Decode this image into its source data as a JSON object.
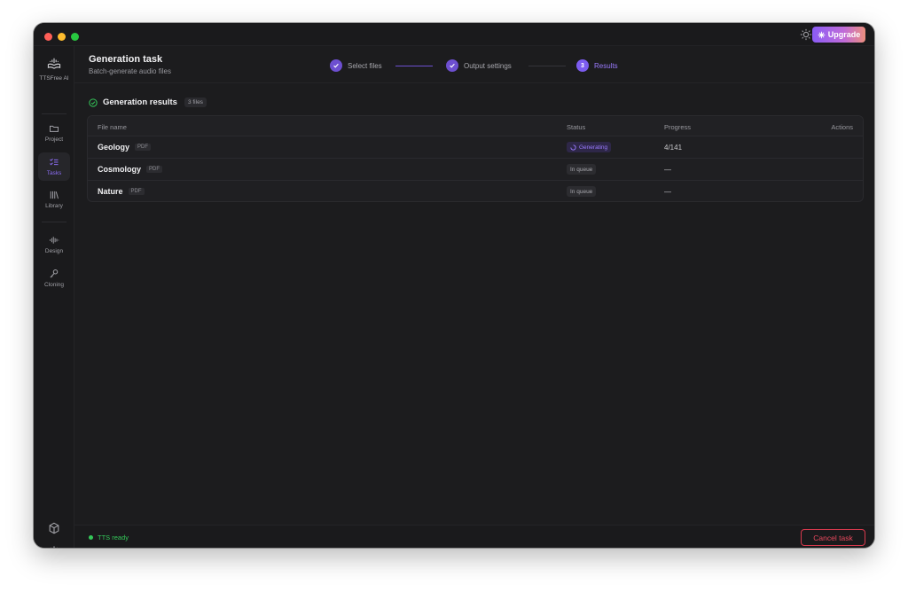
{
  "app": {
    "name": "TTSFree AI"
  },
  "titlebar": {
    "upgrade_label": "Upgrade"
  },
  "sidebar": {
    "items": [
      {
        "label": "Project",
        "icon": "folder-icon"
      },
      {
        "label": "Tasks",
        "icon": "tasks-icon",
        "active": true
      },
      {
        "label": "Library",
        "icon": "library-icon"
      },
      {
        "label": "Design",
        "icon": "waveform-icon"
      },
      {
        "label": "Cloning",
        "icon": "microphone-icon"
      }
    ],
    "bottom_icons": [
      "cube-icon",
      "gear-icon"
    ]
  },
  "header": {
    "title": "Generation task",
    "subtitle": "Batch-generate audio files",
    "steps": [
      {
        "label": "Select files",
        "state": "done"
      },
      {
        "label": "Output settings",
        "state": "done"
      },
      {
        "label": "Results",
        "number": "3",
        "state": "current"
      }
    ]
  },
  "results": {
    "title": "Generation results",
    "count": "3 files",
    "columns": {
      "name": "File name",
      "status": "Status",
      "progress": "Progress",
      "actions": "Actions"
    },
    "rows": [
      {
        "name": "Geology",
        "type": "PDF",
        "status": "Generating",
        "progress": "4/141"
      },
      {
        "name": "Cosmology",
        "type": "PDF",
        "status": "In queue",
        "progress": "—"
      },
      {
        "name": "Nature",
        "type": "PDF",
        "status": "In queue",
        "progress": "—"
      }
    ]
  },
  "statusbar": {
    "tts_status": "TTS ready",
    "cancel_label": "Cancel task"
  },
  "colors": {
    "accent": "#7c5cf0",
    "success": "#34c759",
    "danger": "#e8485d",
    "background": "#1c1c1e"
  }
}
